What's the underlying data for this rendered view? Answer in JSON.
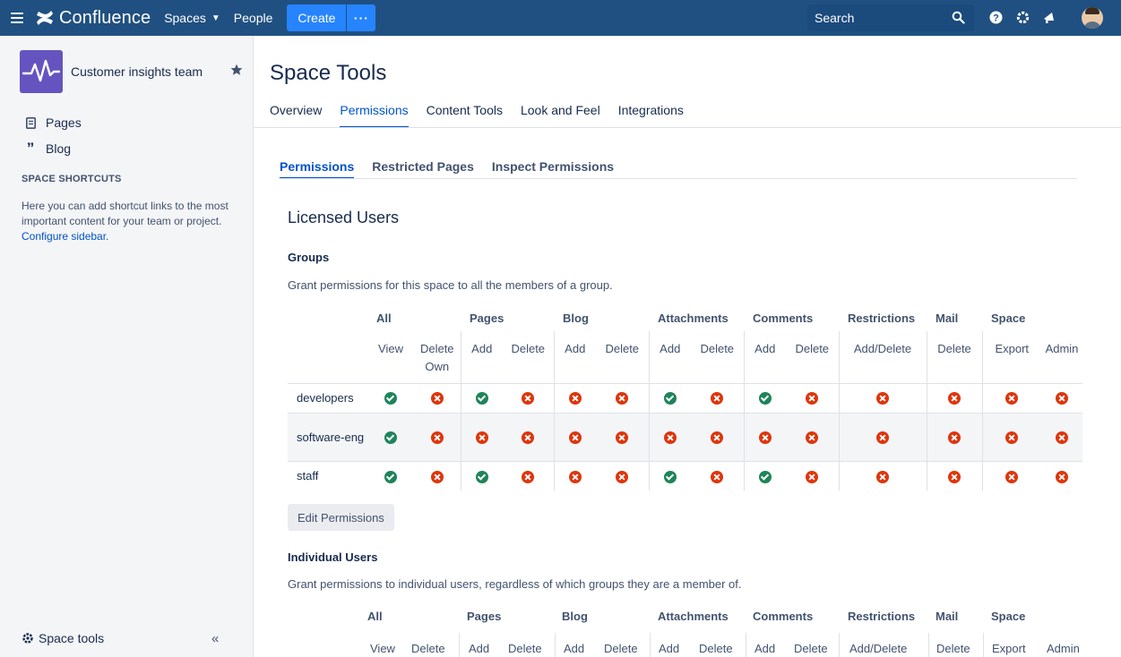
{
  "topnav": {
    "app_name": "Confluence",
    "spaces": "Spaces",
    "people": "People",
    "create": "Create",
    "more": "···",
    "search_placeholder": "Search"
  },
  "sidebar": {
    "space_name": "Customer insights team",
    "items": [
      {
        "label": "Pages",
        "icon": "page-icon"
      },
      {
        "label": "Blog",
        "icon": "quote-icon"
      }
    ],
    "shortcuts_heading": "SPACE SHORTCUTS",
    "shortcuts_text": "Here you can add shortcut links to the most important content for your team or project.",
    "configure_link": "Configure sidebar.",
    "space_tools": "Space tools",
    "collapse": "«"
  },
  "main": {
    "title": "Space Tools",
    "tabs": [
      "Overview",
      "Permissions",
      "Content Tools",
      "Look and Feel",
      "Integrations"
    ],
    "active_tab": "Permissions",
    "subtabs": [
      "Permissions",
      "Restricted Pages",
      "Inspect Permissions"
    ],
    "active_subtab": "Permissions",
    "section_title": "Licensed Users",
    "groups_heading": "Groups",
    "groups_desc": "Grant permissions for this space to all the members of a group.",
    "categories": [
      "All",
      "Pages",
      "Blog",
      "Attachments",
      "Comments",
      "Restrictions",
      "Mail",
      "Space"
    ],
    "subheaders": [
      "View",
      "Delete Own",
      "Add",
      "Delete",
      "Add",
      "Delete",
      "Add",
      "Delete",
      "Add",
      "Delete",
      "Add/Delete",
      "Delete",
      "Export",
      "Admin"
    ],
    "groups": [
      {
        "name": "developers",
        "perms": [
          1,
          0,
          1,
          0,
          0,
          0,
          1,
          0,
          1,
          0,
          0,
          0,
          0,
          0
        ]
      },
      {
        "name": "software-eng",
        "perms": [
          1,
          0,
          0,
          0,
          0,
          0,
          0,
          0,
          0,
          0,
          0,
          0,
          0,
          0
        ]
      },
      {
        "name": "staff",
        "perms": [
          1,
          0,
          1,
          0,
          0,
          0,
          1,
          0,
          1,
          0,
          0,
          0,
          0,
          0
        ]
      }
    ],
    "edit_button": "Edit Permissions",
    "users_heading": "Individual Users",
    "users_desc": "Grant permissions to individual users, regardless of which groups they are a member of.",
    "users_subheaders": [
      "View",
      "Delete",
      "Add",
      "Delete",
      "Add",
      "Delete",
      "Add",
      "Delete",
      "Add",
      "Delete",
      "Add/Delete",
      "Delete",
      "Export",
      "Admin"
    ]
  },
  "colors": {
    "nav_bg": "#205081",
    "accent": "#0052CC",
    "granted": "#1F845A",
    "denied": "#DE350B",
    "space_logo": "#6554C0"
  }
}
